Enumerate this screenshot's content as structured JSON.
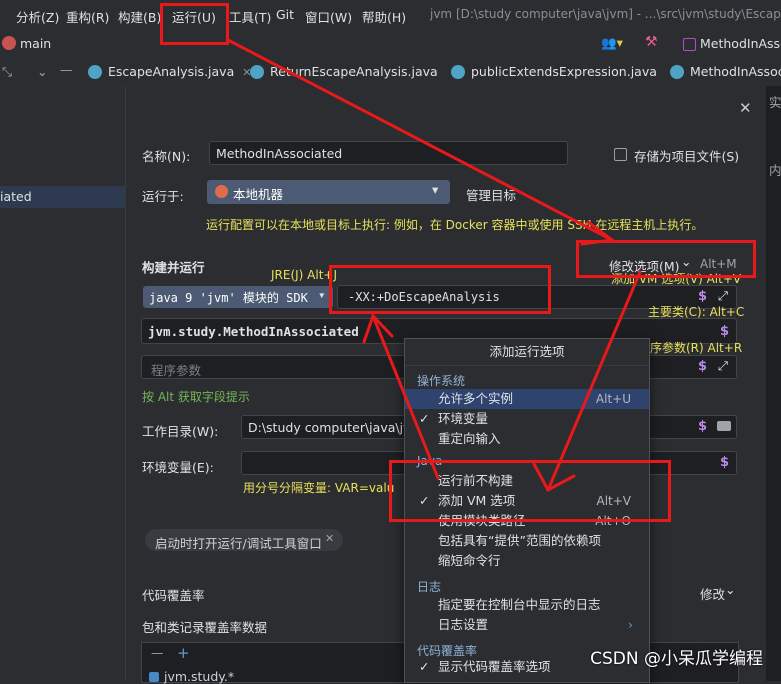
{
  "menubar": {
    "items": [
      "分析(Z)",
      "重构(R)",
      "构建(B)",
      "运行(U)",
      "工具(T)",
      "Git",
      "窗口(W)",
      "帮助(H)"
    ],
    "window_title": "jvm [D:\\study computer\\java\\jvm] - ...\\src\\jvm\\study\\EscapeA"
  },
  "toolbar": {
    "branch": "main",
    "run_config": "MethodInAssoc"
  },
  "tabs": [
    {
      "label": "EscapeAnalysis.java"
    },
    {
      "label": "ReturnEscapeAnalysis.java"
    },
    {
      "label": "publicExtendsExpression.java"
    },
    {
      "label": "MethodInAssoci"
    }
  ],
  "left": {
    "selected_item": "iated"
  },
  "dialog": {
    "name_label": "名称(N):",
    "name_value": "MethodInAssociated",
    "store_label": "存储为项目文件(S)",
    "run_on_label": "运行于:",
    "run_on_value": "本地机器",
    "manage_targets": "管理目标",
    "run_on_hint": "运行配置可以在本地或目标上执行: 例如，在 Docker 容器中或使用 SSH 在远程主机上执行。",
    "build_run_label": "构建并运行",
    "modify_options": "修改选项(M)",
    "modify_options_key": "Alt+M",
    "jre_hint": "JRE(J) Alt+J",
    "vm_hint": "添加 VM 选项(V) Alt+V",
    "sdk_value": "java 9 'jvm' 模块的 SDK",
    "vm_options_value": "-XX:+DoEscapeAnalysis",
    "main_class_hint": "主要类(C): Alt+C",
    "main_class_value": "jvm.study.MethodInAssociated",
    "program_args_hint": "程序参数(R) Alt+R",
    "program_args_placeholder": "程序参数",
    "alt_hint": "按 Alt 获取字段提示",
    "workdir_label": "工作目录(W):",
    "workdir_value": "D:\\study computer\\java\\jv",
    "env_label": "环境变量(E):",
    "env_hint": "用分号分隔变量: VAR=valu",
    "open_window_chip": "启动时打开运行/调试工具窗口",
    "coverage_label": "代码覆盖率",
    "coverage_modify": "修改",
    "coverage_packages_label": "包和类记录覆盖率数据",
    "coverage_row": "jvm.study.*"
  },
  "popup": {
    "title": "添加运行选项",
    "groups": [
      {
        "name": "操作系统"
      },
      {
        "name": "Java"
      },
      {
        "name": "日志"
      },
      {
        "name": "代码覆盖率"
      }
    ],
    "items": [
      {
        "label": "允许多个实例",
        "key": "Alt+U",
        "checked": false,
        "selected": true
      },
      {
        "label": "环境变量",
        "key": "",
        "checked": true,
        "selected": false
      },
      {
        "label": "重定向输入",
        "key": "",
        "checked": false,
        "selected": false
      },
      {
        "label": "运行前不构建",
        "key": "",
        "checked": false,
        "selected": false
      },
      {
        "label": "添加 VM 选项",
        "key": "Alt+V",
        "checked": true,
        "selected": false
      },
      {
        "label": "使用模块类路径",
        "key": "Alt+O",
        "checked": false,
        "selected": false
      },
      {
        "label": "包括具有“提供”范围的依赖项",
        "key": "",
        "checked": false,
        "selected": false
      },
      {
        "label": "缩短命令行",
        "key": "",
        "checked": false,
        "selected": false
      },
      {
        "label": "指定要在控制台中显示的日志",
        "key": "",
        "checked": false,
        "selected": false
      },
      {
        "label": "日志设置",
        "key": "",
        "checked": false,
        "selected": false
      },
      {
        "label": "显示代码覆盖率选项",
        "key": "",
        "checked": true,
        "selected": false
      }
    ],
    "check_glyph": "✓"
  },
  "right_partial": {
    "a": "实",
    "b": "内"
  },
  "watermark": "CSDN @小呆瓜学编程",
  "colors": {
    "annotation_red": "#e8191b",
    "selection_blue": "#2e436e",
    "hint_yellow": "#e8e05a"
  }
}
